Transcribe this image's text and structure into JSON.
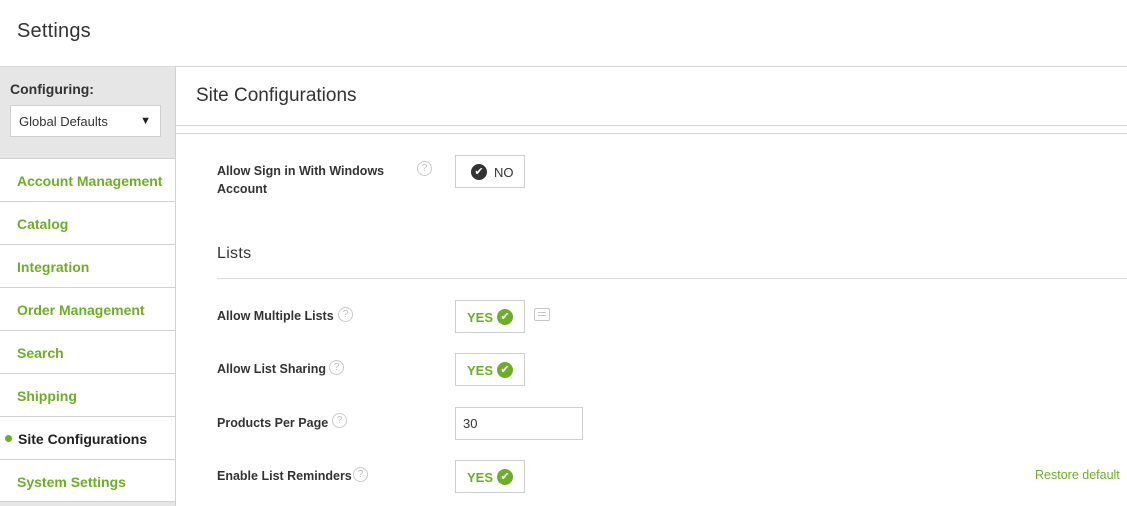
{
  "header": {
    "title": "Settings"
  },
  "sidebar": {
    "configuring_label": "Configuring:",
    "configuring_value": "Global Defaults",
    "caret": "▼",
    "items": [
      {
        "label": "Account Management"
      },
      {
        "label": "Catalog"
      },
      {
        "label": "Integration"
      },
      {
        "label": "Order Management"
      },
      {
        "label": "Search"
      },
      {
        "label": "Shipping"
      },
      {
        "label": "Site Configurations",
        "active": true
      },
      {
        "label": "System Settings"
      }
    ]
  },
  "main": {
    "title": "Site Configurations",
    "help_glyph": "?",
    "check_glyph": "✔",
    "windows_signin": {
      "label": "Allow Sign in With Windows Account",
      "value": "NO"
    },
    "lists_section": {
      "title": "Lists"
    },
    "allow_multiple_lists": {
      "label": "Allow Multiple Lists",
      "value": "YES"
    },
    "allow_list_sharing": {
      "label": "Allow List Sharing",
      "value": "YES"
    },
    "products_per_page": {
      "label": "Products Per Page",
      "value": "30"
    },
    "enable_list_reminders": {
      "label": "Enable List Reminders",
      "value": "YES",
      "restore": "Restore default"
    }
  },
  "colors": {
    "accent": "#6cae27",
    "dark": "#333333",
    "border": "#d9d9d9"
  },
  "icons": {
    "help": "question-circle-icon",
    "check": "check-circle-icon",
    "comment": "comment-icon",
    "dropdown": "caret-down-icon"
  }
}
